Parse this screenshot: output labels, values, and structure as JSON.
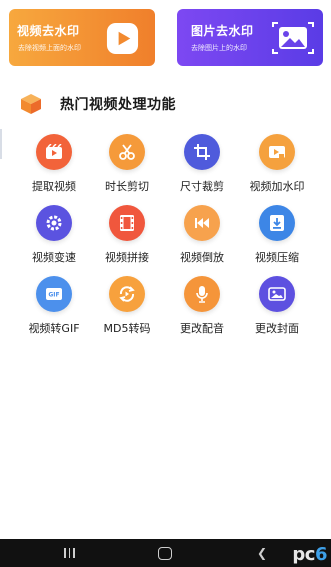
{
  "cards": {
    "video": {
      "title": "视频去水印",
      "subtitle": "去除视频上面的水印"
    },
    "image": {
      "title": "图片去水印",
      "subtitle": "去除图片上的水印"
    }
  },
  "section": {
    "title": "热门视频处理功能"
  },
  "features": [
    {
      "label": "提取视频",
      "icon": "extract-video-icon",
      "color": "#f2633a"
    },
    {
      "label": "时长剪切",
      "icon": "scissors-icon",
      "color": "#f59a3a"
    },
    {
      "label": "尺寸裁剪",
      "icon": "crop-icon",
      "color": "#4f5bdc"
    },
    {
      "label": "视频加水印",
      "icon": "add-watermark-icon",
      "color": "#f5a13e"
    },
    {
      "label": "视频变速",
      "icon": "speed-gear-icon",
      "color": "#5b53e0"
    },
    {
      "label": "视频拼接",
      "icon": "film-strip-icon",
      "color": "#f0573d"
    },
    {
      "label": "视频倒放",
      "icon": "reverse-icon",
      "color": "#f7a24d"
    },
    {
      "label": "视频压缩",
      "icon": "compress-icon",
      "color": "#3d86e6"
    },
    {
      "label": "视频转GIF",
      "icon": "gif-icon",
      "color": "#4c90ec"
    },
    {
      "label": "MD5转码",
      "icon": "md5-transcode-icon",
      "color": "#f7a13d"
    },
    {
      "label": "更改配音",
      "icon": "microphone-icon",
      "color": "#f5953a"
    },
    {
      "label": "更改封面",
      "icon": "cover-image-icon",
      "color": "#5d50e0"
    }
  ],
  "watermark": {
    "text": "pc",
    "accent": "6"
  }
}
